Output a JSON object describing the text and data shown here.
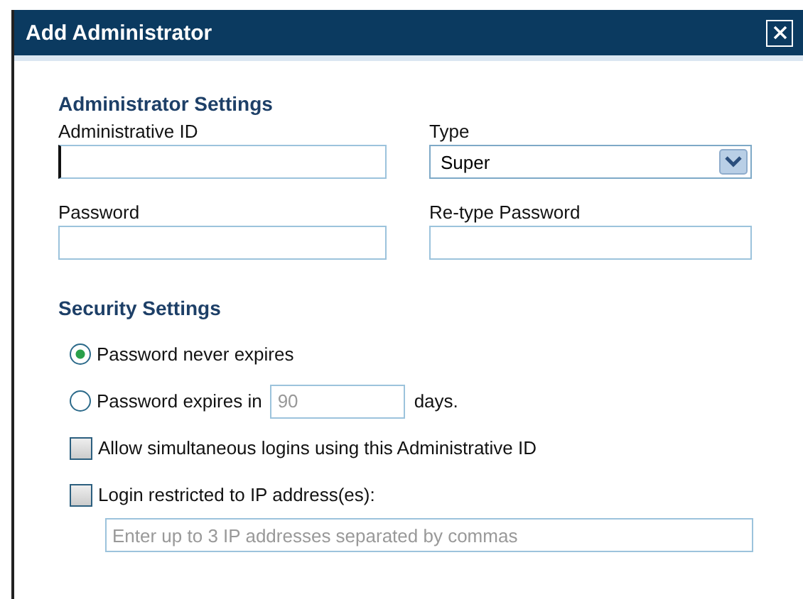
{
  "window": {
    "title": "Add Administrator"
  },
  "administrator_settings": {
    "heading": "Administrator Settings",
    "fields": [
      {
        "kind": "text",
        "label": "Administrative ID"
      },
      {
        "kind": "select",
        "label": "Type",
        "value": "Super"
      },
      {
        "kind": "password",
        "label": "Password"
      },
      {
        "kind": "password",
        "label": "Re-type Password"
      }
    ]
  },
  "security_settings": {
    "heading": "Security Settings",
    "expiry_options": [
      {
        "label": "Password never expires",
        "selected": true
      },
      {
        "label": "Password expires in",
        "selected": false,
        "days_value": "90",
        "days_disabled": true,
        "suffix": "days."
      }
    ],
    "checkboxes": [
      {
        "label": "Allow simultaneous logins using this Administrative ID",
        "checked": false
      },
      {
        "label": "Login restricted to IP address(es):",
        "checked": false,
        "input_placeholder": "Enter up to 3 IP addresses separated by commas"
      }
    ]
  }
}
